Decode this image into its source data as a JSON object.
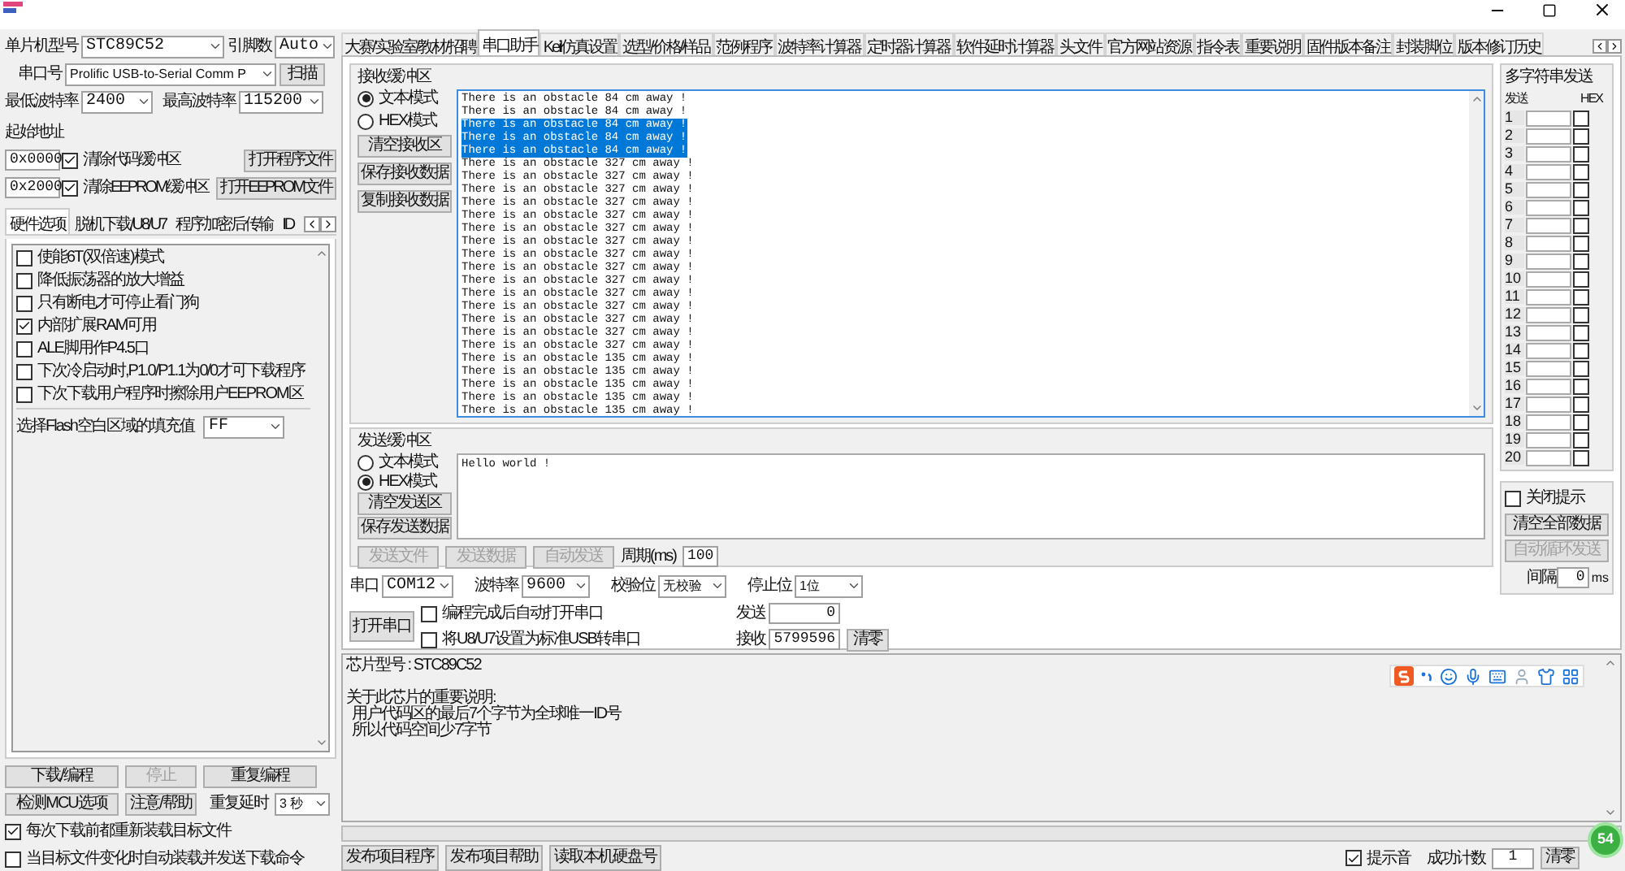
{
  "chip": {
    "label": "单片机型号",
    "value": "STC89C52"
  },
  "pins": {
    "label": "引脚数",
    "value": "Auto"
  },
  "port": {
    "label": "串口号",
    "value": "Prolific USB-to-Serial Comm P",
    "button": "扫描"
  },
  "baud_min": {
    "label": "最低波特率",
    "value": "2400"
  },
  "baud_max": {
    "label": "最高波特率",
    "value": "115200"
  },
  "start_address": {
    "label": "起始地址",
    "rows": [
      {
        "address": "0x0000",
        "option": "清除代码缓冲区",
        "checked": true,
        "button": "打开程序文件"
      },
      {
        "address": "0x2000",
        "option": "清除EEPROM缓冲区",
        "checked": true,
        "button": "打开EEPROM文件"
      }
    ]
  },
  "left_tabs": [
    {
      "label": "硬件选项",
      "selected": true
    },
    {
      "label": "脱机下载/U8/U7",
      "selected": false
    },
    {
      "label": "程序加密后传输",
      "selected": false
    },
    {
      "label": "ID",
      "selected": false
    }
  ],
  "hardware_options": [
    {
      "label": "使能6T(双倍速)模式",
      "checked": false
    },
    {
      "label": "降低振荡器的放大增益",
      "checked": false
    },
    {
      "label": "只有断电才可停止看门狗",
      "checked": false
    },
    {
      "label": "内部扩展RAM可用",
      "checked": true
    },
    {
      "label": "ALE脚用作P4.5口",
      "checked": false
    },
    {
      "label": "下次冷启动时,P1.0/P1.1为0/0才可下载程序",
      "checked": false
    },
    {
      "label": "下次下载用户程序时擦除用户EEPROM区",
      "checked": false
    }
  ],
  "flash_fill": {
    "label": "选择Flash空白区域的填充值",
    "value": "FF"
  },
  "actions": [
    {
      "label": "下载/编程",
      "disabled": false
    },
    {
      "label": "停止",
      "disabled": true
    },
    {
      "label": "重复编程",
      "disabled": false
    },
    {
      "label": "检测MCU选项",
      "disabled": false
    },
    {
      "label": "注意/帮助",
      "disabled": false
    }
  ],
  "repeat_delay": {
    "label": "重复延时",
    "value": "3 秒"
  },
  "left_checks": [
    {
      "label": "每次下载前都重新装载目标文件",
      "checked": true
    },
    {
      "label": "当目标文件变化时自动装载并发送下载命令",
      "checked": false
    }
  ],
  "main_tabs": [
    {
      "label": "大赛/实验室/教材/招聘",
      "selected": false
    },
    {
      "label": "串口助手",
      "selected": true
    },
    {
      "label": "Keil仿真设置",
      "selected": false
    },
    {
      "label": "选型/价格/样品",
      "selected": false
    },
    {
      "label": "范例程序",
      "selected": false
    },
    {
      "label": "波特率计算器",
      "selected": false
    },
    {
      "label": "定时器计算器",
      "selected": false
    },
    {
      "label": "软件延时计算器",
      "selected": false
    },
    {
      "label": "头文件",
      "selected": false
    },
    {
      "label": "官方网站资源",
      "selected": false
    },
    {
      "label": "指令表",
      "selected": false
    },
    {
      "label": "重要说明",
      "selected": false
    },
    {
      "label": "固件版本备注",
      "selected": false
    },
    {
      "label": "封装脚位",
      "selected": false
    },
    {
      "label": "版本修订历史",
      "selected": false
    }
  ],
  "receive": {
    "title": "接收缓冲区",
    "modes": [
      {
        "label": "文本模式",
        "selected": true
      },
      {
        "label": "HEX模式",
        "selected": false
      }
    ],
    "buttons": [
      "清空接收区",
      "保存接收数据",
      "复制接收数据"
    ],
    "lines": [
      {
        "text": "There is an obstacle 84 cm away !",
        "selected": false
      },
      {
        "text": "There is an obstacle 84 cm away !",
        "selected": false
      },
      {
        "text": "There is an obstacle 84 cm away !",
        "selected": true
      },
      {
        "text": "There is an obstacle 84 cm away !",
        "selected": true
      },
      {
        "text": "There is an obstacle 84 cm away !",
        "selected": true
      },
      {
        "text": "There is an obstacle 327 cm away !",
        "selected": false
      },
      {
        "text": "There is an obstacle 327 cm away !",
        "selected": false
      },
      {
        "text": "There is an obstacle 327 cm away !",
        "selected": false
      },
      {
        "text": "There is an obstacle 327 cm away !",
        "selected": false
      },
      {
        "text": "There is an obstacle 327 cm away !",
        "selected": false
      },
      {
        "text": "There is an obstacle 327 cm away !",
        "selected": false
      },
      {
        "text": "There is an obstacle 327 cm away !",
        "selected": false
      },
      {
        "text": "There is an obstacle 327 cm away !",
        "selected": false
      },
      {
        "text": "There is an obstacle 327 cm away !",
        "selected": false
      },
      {
        "text": "There is an obstacle 327 cm away !",
        "selected": false
      },
      {
        "text": "There is an obstacle 327 cm away !",
        "selected": false
      },
      {
        "text": "There is an obstacle 327 cm away !",
        "selected": false
      },
      {
        "text": "There is an obstacle 327 cm away !",
        "selected": false
      },
      {
        "text": "There is an obstacle 327 cm away !",
        "selected": false
      },
      {
        "text": "There is an obstacle 327 cm away !",
        "selected": false
      },
      {
        "text": "There is an obstacle 135 cm away !",
        "selected": false
      },
      {
        "text": "There is an obstacle 135 cm away !",
        "selected": false
      },
      {
        "text": "There is an obstacle 135 cm away !",
        "selected": false
      },
      {
        "text": "There is an obstacle 135 cm away !",
        "selected": false
      },
      {
        "text": "There is an obstacle 135 cm away !",
        "selected": false
      }
    ]
  },
  "multi_send": {
    "title": "多字符串发送",
    "headers": [
      "发送",
      "HEX"
    ],
    "rows": [
      {
        "index": "1",
        "hex": false
      },
      {
        "index": "2",
        "hex": false
      },
      {
        "index": "3",
        "hex": false
      },
      {
        "index": "4",
        "hex": false
      },
      {
        "index": "5",
        "hex": false
      },
      {
        "index": "6",
        "hex": false
      },
      {
        "index": "7",
        "hex": false
      },
      {
        "index": "8",
        "hex": false
      },
      {
        "index": "9",
        "hex": false
      },
      {
        "index": "10",
        "hex": false
      },
      {
        "index": "11",
        "hex": false
      },
      {
        "index": "12",
        "hex": false
      },
      {
        "index": "13",
        "hex": false
      },
      {
        "index": "14",
        "hex": false
      },
      {
        "index": "15",
        "hex": false
      },
      {
        "index": "16",
        "hex": false
      },
      {
        "index": "17",
        "hex": false
      },
      {
        "index": "18",
        "hex": false
      },
      {
        "index": "19",
        "hex": false
      },
      {
        "index": "20",
        "hex": false
      }
    ],
    "close_hint": {
      "label": "关闭提示",
      "checked": false
    },
    "buttons": [
      {
        "label": "清空全部数据",
        "disabled": false
      },
      {
        "label": "自动循环发送",
        "disabled": true
      }
    ],
    "interval": {
      "label": "间隔",
      "value": "0",
      "unit": "ms"
    }
  },
  "send": {
    "title": "发送缓冲区",
    "modes": [
      {
        "label": "文本模式",
        "selected": false
      },
      {
        "label": "HEX模式",
        "selected": true
      }
    ],
    "buttons": [
      "清空发送区",
      "保存发送数据"
    ],
    "text": "Hello world !",
    "actions": [
      {
        "label": "发送文件",
        "disabled": true
      },
      {
        "label": "发送数据",
        "disabled": true
      },
      {
        "label": "自动发送",
        "disabled": true
      }
    ],
    "period": {
      "label": "周期(ms)",
      "value": "100"
    }
  },
  "serial": {
    "settings": [
      {
        "label": "串口",
        "value": "COM12"
      },
      {
        "label": "波特率",
        "value": "9600"
      },
      {
        "label": "校验位",
        "value": "无校验"
      },
      {
        "label": "停止位",
        "value": "1位"
      }
    ],
    "open_button": "打开串口",
    "options": [
      {
        "label": "编程完成后自动打开串口",
        "checked": false
      },
      {
        "label": "将U8/U7设置为标准USB转串口",
        "checked": false
      }
    ],
    "counters": [
      {
        "label": "发送",
        "value": "0"
      },
      {
        "label": "接收",
        "value": "5799596"
      }
    ],
    "clear": "清零"
  },
  "info": {
    "paragraphs": [
      [
        "芯片型号 : STC89C52"
      ],
      [
        "关于此芯片的重要说明:",
        "  用户代码区的最后7个字节为全球唯一ID号",
        "  所以代码空间少7字节"
      ]
    ]
  },
  "progress": {
    "level": 0
  },
  "bottom": {
    "buttons": [
      "发布项目程序",
      "发布项目帮助",
      "读取本机硬盘号"
    ],
    "sound": {
      "label": "提示音",
      "checked": true
    },
    "success_count": {
      "label": "成功计数",
      "value": "1"
    },
    "clear": "清零"
  },
  "badge": {
    "text": "54"
  }
}
